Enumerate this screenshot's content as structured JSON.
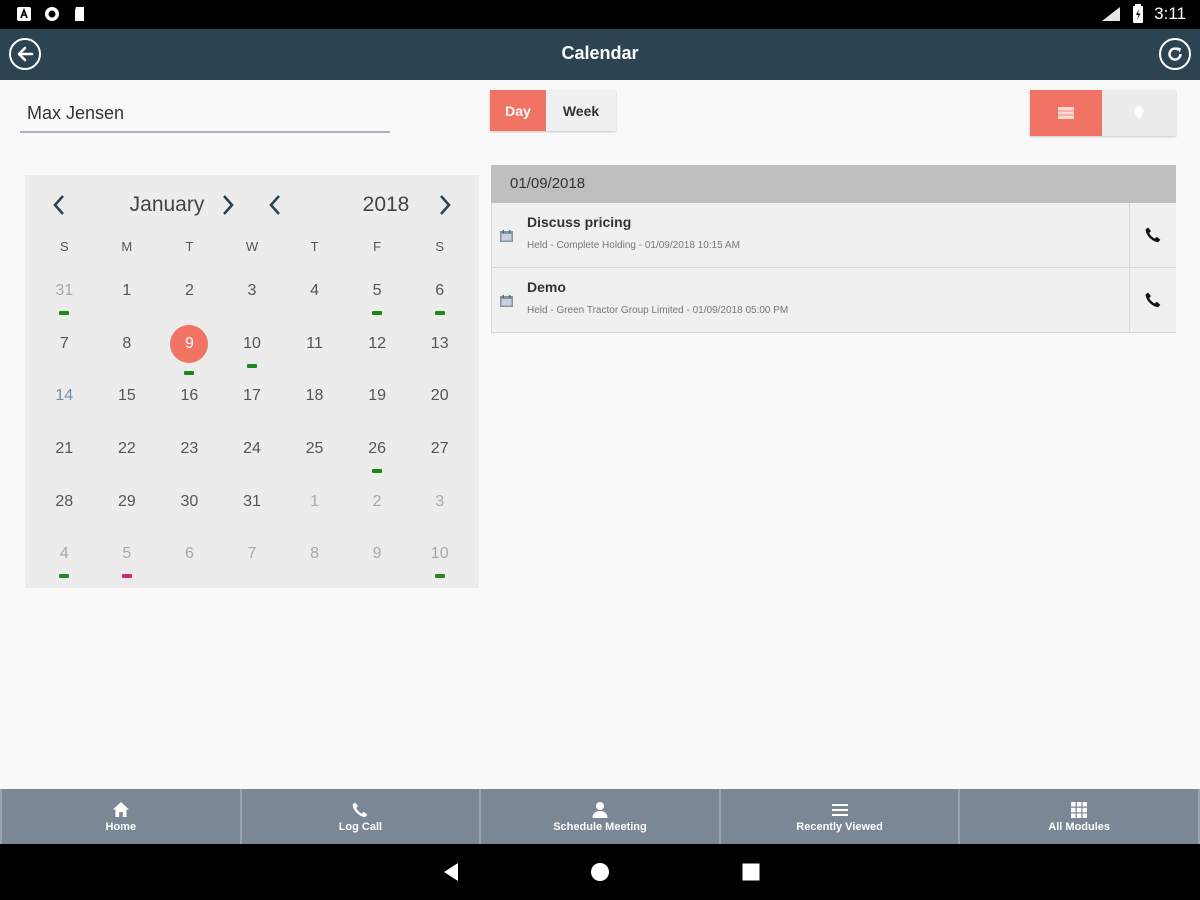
{
  "status_bar": {
    "time": "3:11"
  },
  "header": {
    "title": "Calendar"
  },
  "contact_field": {
    "value": "Max Jensen"
  },
  "view_mode": {
    "day_label": "Day",
    "week_label": "Week",
    "active": "Day"
  },
  "calendar": {
    "month": "January",
    "year": "2018",
    "weekdays": [
      "S",
      "M",
      "T",
      "W",
      "T",
      "F",
      "S"
    ],
    "days": [
      {
        "n": "31",
        "dim": true,
        "dot": "#1a8a1a"
      },
      {
        "n": "1"
      },
      {
        "n": "2"
      },
      {
        "n": "3"
      },
      {
        "n": "4"
      },
      {
        "n": "5",
        "dot": "#1a8a1a"
      },
      {
        "n": "6",
        "dot": "#1a8a1a"
      },
      {
        "n": "7"
      },
      {
        "n": "8"
      },
      {
        "n": "9",
        "today": true,
        "dot": "#1a8a1a"
      },
      {
        "n": "10",
        "dot": "#1a8a1a"
      },
      {
        "n": "11"
      },
      {
        "n": "12"
      },
      {
        "n": "13"
      },
      {
        "n": "14",
        "blue": true
      },
      {
        "n": "15"
      },
      {
        "n": "16"
      },
      {
        "n": "17"
      },
      {
        "n": "18"
      },
      {
        "n": "19"
      },
      {
        "n": "20"
      },
      {
        "n": "21"
      },
      {
        "n": "22"
      },
      {
        "n": "23"
      },
      {
        "n": "24"
      },
      {
        "n": "25"
      },
      {
        "n": "26",
        "dot": "#1a8a1a"
      },
      {
        "n": "27"
      },
      {
        "n": "28"
      },
      {
        "n": "29"
      },
      {
        "n": "30"
      },
      {
        "n": "31"
      },
      {
        "n": "1",
        "dim": true
      },
      {
        "n": "2",
        "dim": true
      },
      {
        "n": "3",
        "dim": true
      },
      {
        "n": "4",
        "dim": true,
        "dot": "#1a8a1a"
      },
      {
        "n": "5",
        "dim": true,
        "dot": "#d6247a"
      },
      {
        "n": "6",
        "dim": true
      },
      {
        "n": "7",
        "dim": true
      },
      {
        "n": "8",
        "dim": true
      },
      {
        "n": "9",
        "dim": true
      },
      {
        "n": "10",
        "dim": true,
        "dot": "#1a8a1a"
      }
    ]
  },
  "events": {
    "date": "01/09/2018",
    "items": [
      {
        "title": "Discuss pricing",
        "subtitle": "Held - Complete Holding - 01/09/2018 10:15 AM"
      },
      {
        "title": "Demo",
        "subtitle": "Held - Green Tractor Group Limited - 01/09/2018 05:00 PM"
      }
    ]
  },
  "bottom_nav": [
    {
      "label": "Home",
      "icon": "home-icon"
    },
    {
      "label": "Log Call",
      "icon": "phone-icon"
    },
    {
      "label": "Schedule Meeting",
      "icon": "person-icon"
    },
    {
      "label": "Recently Viewed",
      "icon": "menu-lines-icon"
    },
    {
      "label": "All Modules",
      "icon": "grid-icon"
    }
  ],
  "colors": {
    "header": "#2c4452",
    "accent": "#f07364",
    "bottom_nav": "#7b8794"
  }
}
